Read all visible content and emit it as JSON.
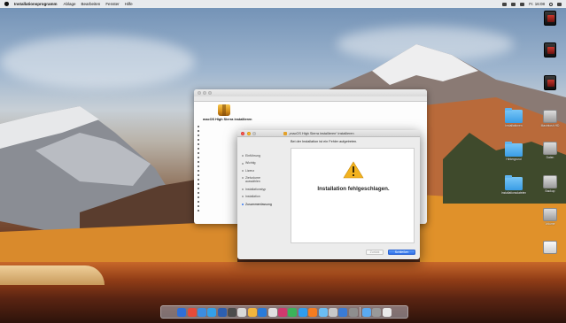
{
  "menubar": {
    "app_name": "Installationsprogramm",
    "menus": [
      "Ablage",
      "Bearbeiten",
      "Fenster",
      "Hilfe"
    ],
    "clock": "Fr. 16:08"
  },
  "background_window": {
    "title": "",
    "package_label": "macOS High Sierra installieren"
  },
  "dialog": {
    "title": "„macOS High Sierra installieren“ installieren",
    "subtitle": "Bei der Installation ist ein Fehler aufgetreten.",
    "steps": [
      {
        "label": "Einführung",
        "current": false
      },
      {
        "label": "Wichtig",
        "current": false
      },
      {
        "label": "Lizenz",
        "current": false
      },
      {
        "label": "Zielvolume auswählen",
        "current": false
      },
      {
        "label": "Installationstyp",
        "current": false
      },
      {
        "label": "Installation",
        "current": false
      },
      {
        "label": "Zusammenfassung",
        "current": true
      }
    ],
    "message": "Installation fehlgeschlagen.",
    "back_label": "Zurück",
    "close_label": "Schließen"
  },
  "desktop_icons": [
    {
      "name": "disk-image-1",
      "kind": "disk-img",
      "label": ""
    },
    {
      "name": "disk-image-2",
      "kind": "disk-img",
      "label": ""
    },
    {
      "name": "disk-image-3",
      "kind": "disk-img",
      "label": ""
    },
    {
      "name": "folder-1",
      "kind": "folder",
      "label": "Installationen"
    },
    {
      "name": "drive-1",
      "kind": "drive",
      "label": "Macintosh HD"
    },
    {
      "name": "folder-2",
      "kind": "folder",
      "label": "Hintergrund"
    },
    {
      "name": "drive-2",
      "kind": "drive",
      "label": "Daten"
    },
    {
      "name": "folder-3",
      "kind": "folder",
      "label": "Installationsdateien"
    },
    {
      "name": "drive-3",
      "kind": "drive",
      "label": "Backup"
    },
    {
      "name": "drive-4",
      "kind": "drive",
      "label": "Volume"
    },
    {
      "name": "drive-5",
      "kind": "drive white",
      "label": ""
    }
  ],
  "dock_colors": [
    "#2f6fd6",
    "#e44b3a",
    "#3d8de0",
    "#34a0e8",
    "#2d5fb0",
    "#4c4c4c",
    "#d9d9d9",
    "#f2b53d",
    "#2a7bd9",
    "#e0e0e0",
    "#cf3a6e",
    "#3bb35a",
    "#2e9df0",
    "#f47c20",
    "#6bbdf2",
    "#c8c8c8",
    "#3a7bd5",
    "#8e8e8e",
    "#5aa9f0",
    "#999999",
    "#eaeaea"
  ],
  "accent": "#3478f6"
}
